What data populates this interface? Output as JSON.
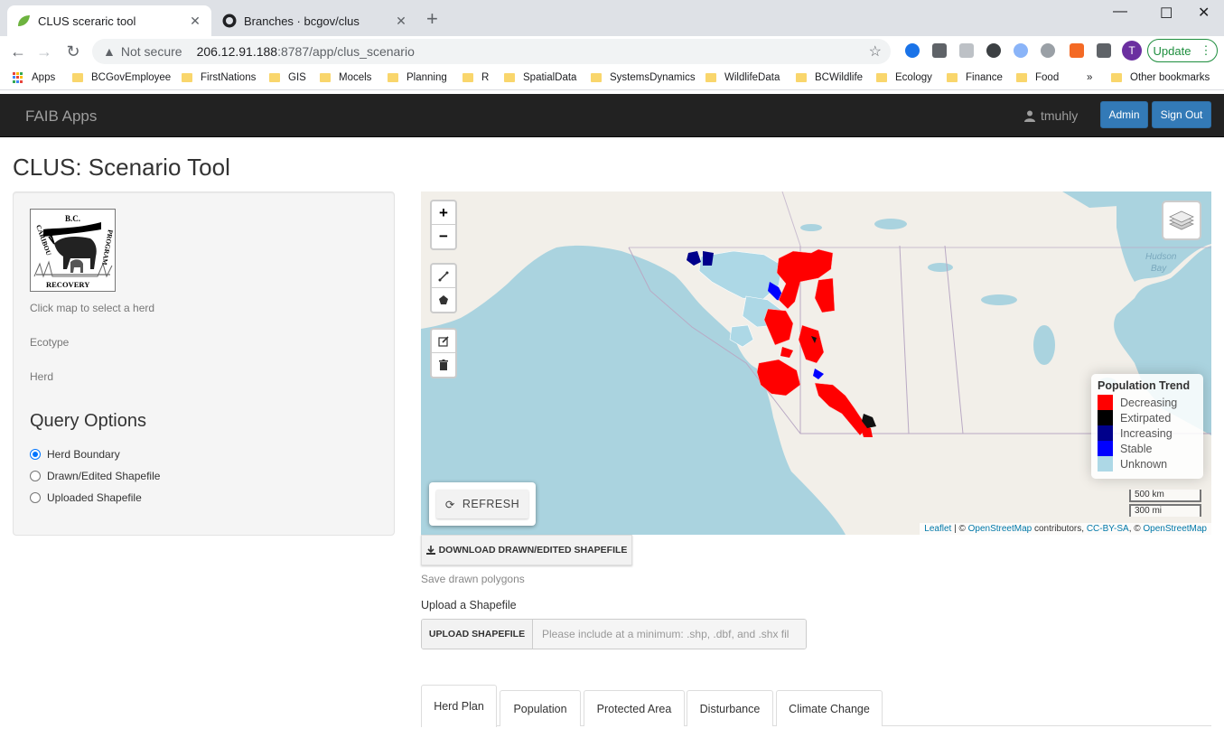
{
  "browser": {
    "tabs": [
      {
        "title": "CLUS sceraric tool",
        "active": true
      },
      {
        "title": "Branches · bcgov/clus",
        "active": false
      }
    ],
    "address": {
      "security": "Not secure",
      "host": "206.12.91.188",
      "path": ":8787/app/clus_scenario"
    },
    "profile_initial": "T",
    "update_label": "Update",
    "bookmarks": [
      "Apps",
      "BCGovEmployee",
      "FirstNations",
      "GIS",
      "Mocels",
      "Planning",
      "R",
      "SpatialData",
      "SystemsDynamics",
      "WildlifeData",
      "BCWildlife",
      "Ecology",
      "Finance",
      "Food"
    ],
    "other_bookmarks": "Other bookmarks",
    "overflow": "»"
  },
  "navbar": {
    "brand": "FAIB Apps",
    "user": "tmuhly",
    "admin_label": "Admin",
    "signout_label": "Sign Out"
  },
  "page": {
    "title": "CLUS: Scenario Tool"
  },
  "sidebar": {
    "logo_text": {
      "top": "B.C.",
      "left": "CARIBOU",
      "right": "PROGRAM",
      "bottom": "RECOVERY"
    },
    "hint": "Click map to select a herd",
    "ecotype_label": "Ecotype",
    "herd_label": "Herd",
    "query_title": "Query Options",
    "options": [
      "Herd Boundary",
      "Drawn/Edited Shapefile",
      "Uploaded Shapefile"
    ],
    "selected_option": "Herd Boundary"
  },
  "map": {
    "water_label_1": "Hudson",
    "water_label_2": "Bay",
    "zoom_in": "+",
    "zoom_out": "−",
    "legend": {
      "title": "Population Trend",
      "items": [
        {
          "label": "Decreasing",
          "color": "#ff0000"
        },
        {
          "label": "Extirpated",
          "color": "#000000"
        },
        {
          "label": "Increasing",
          "color": "#00008b"
        },
        {
          "label": "Stable",
          "color": "#0000ff"
        },
        {
          "label": "Unknown",
          "color": "#add8e6"
        }
      ]
    },
    "refresh_label": "REFRESH",
    "scale_km": "500 km",
    "scale_mi": "300 mi",
    "attribution": {
      "leaflet": "Leaflet",
      "sep1": " | © ",
      "osm": "OpenStreetMap",
      "contrib": " contributors, ",
      "ccbysa": "CC-BY-SA",
      "sep2": ", © ",
      "osm2": "OpenStreetMap"
    },
    "colors": {
      "water": "#aad3df",
      "land": "#f2efe9",
      "decreasing": "#ff0000",
      "unknown": "#add8e6"
    }
  },
  "controls": {
    "download_label": "DOWNLOAD DRAWN/EDITED SHAPEFILE",
    "save_help": "Save drawn polygons",
    "upload_label": "Upload a Shapefile",
    "upload_button": "UPLOAD SHAPEFILE",
    "upload_placeholder": "Please include at a minimum: .shp, .dbf, and .shx fil"
  },
  "result_tabs": [
    "Herd Plan",
    "Population",
    "Protected Area",
    "Disturbance",
    "Climate Change"
  ],
  "active_result_tab": "Herd Plan"
}
